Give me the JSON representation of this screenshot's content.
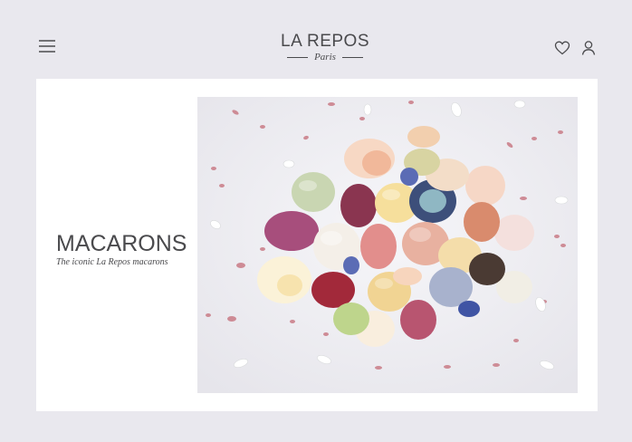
{
  "header": {
    "brand_name": "LA REPOS",
    "brand_sub": "Paris",
    "menu_icon": "hamburger-menu-icon",
    "wishlist_icon": "heart-icon",
    "account_icon": "user-icon"
  },
  "hero": {
    "title": "MACARONS",
    "subtitle": "The iconic La Repos macarons",
    "image": "macarons-photo"
  },
  "colors": {
    "page_background": "#e9e8ee",
    "card_background": "#ffffff",
    "text": "#4a4a4d"
  }
}
